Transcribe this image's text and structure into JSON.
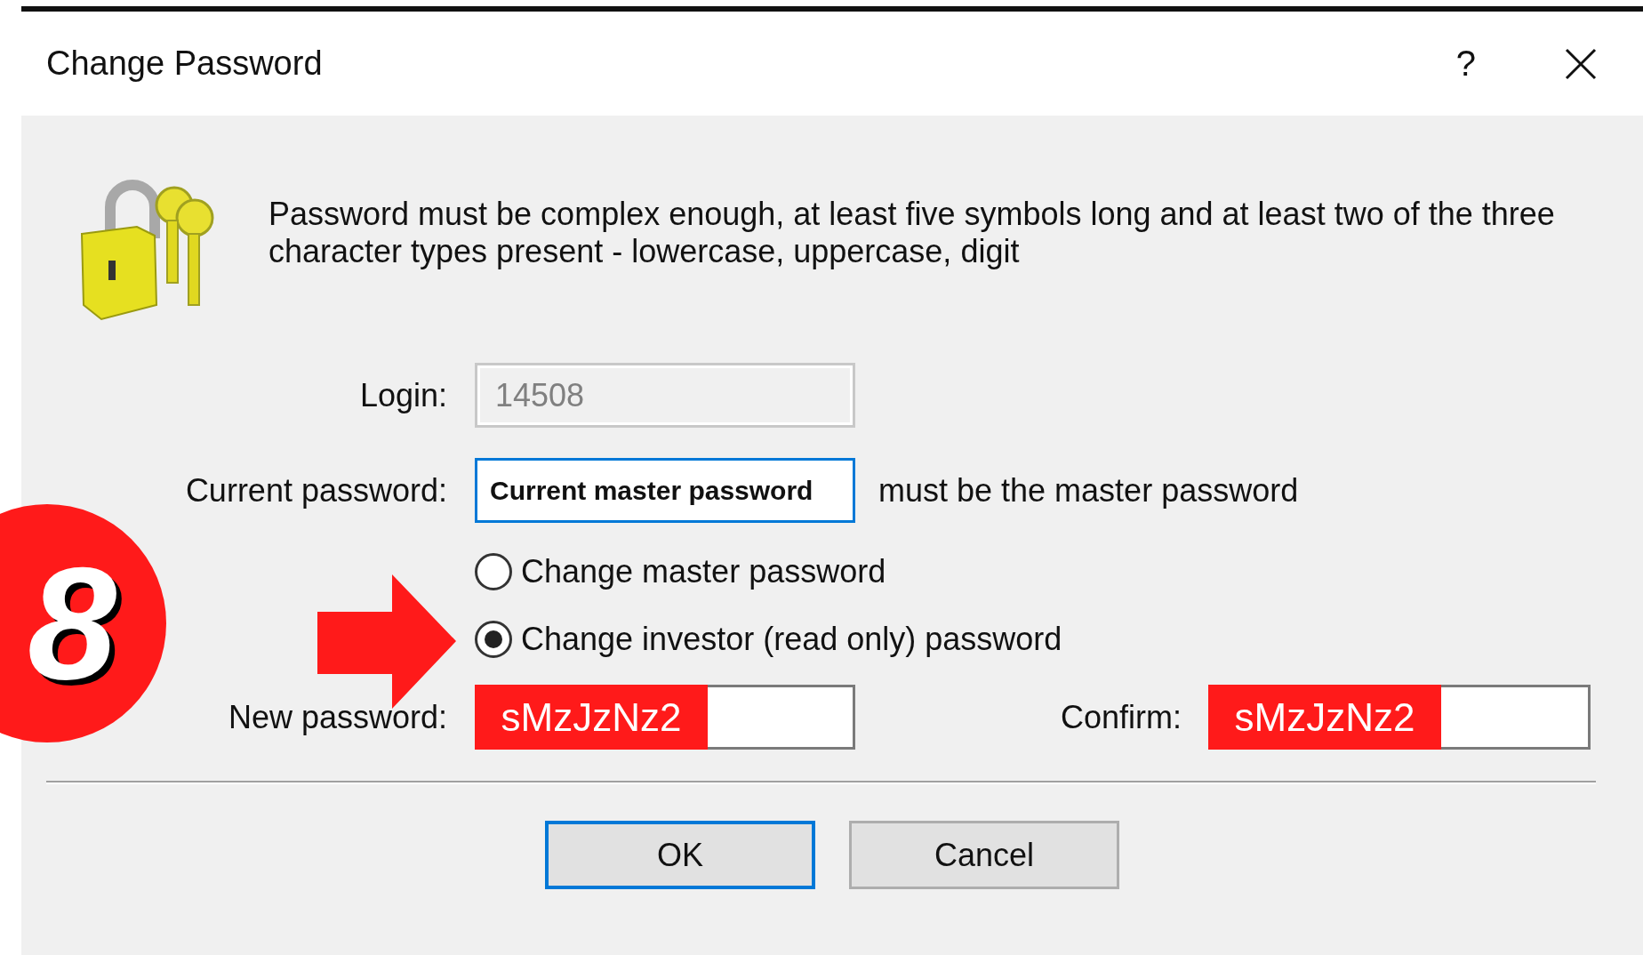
{
  "window": {
    "title": "Change Password",
    "help": "?"
  },
  "description": "Password must be complex enough, at least five symbols long and at least two of the three character types present - lowercase, uppercase, digit",
  "login": {
    "label": "Login:",
    "value": "14508",
    "disabled": true
  },
  "current_password": {
    "label": "Current password:",
    "value": "Current master password",
    "focused": true,
    "hint": "must be the master password"
  },
  "radios": [
    {
      "label": "Change master password",
      "selected": false
    },
    {
      "label": "Change investor (read only) password",
      "selected": true
    }
  ],
  "new_password": {
    "label": "New password:",
    "value": "sMzJzNz2"
  },
  "confirm": {
    "label": "Confirm:",
    "value": "sMzJzNz2"
  },
  "buttons": [
    {
      "label": "OK",
      "default": true
    },
    {
      "label": "Cancel",
      "default": false
    }
  ],
  "annotation": {
    "step": "8"
  }
}
